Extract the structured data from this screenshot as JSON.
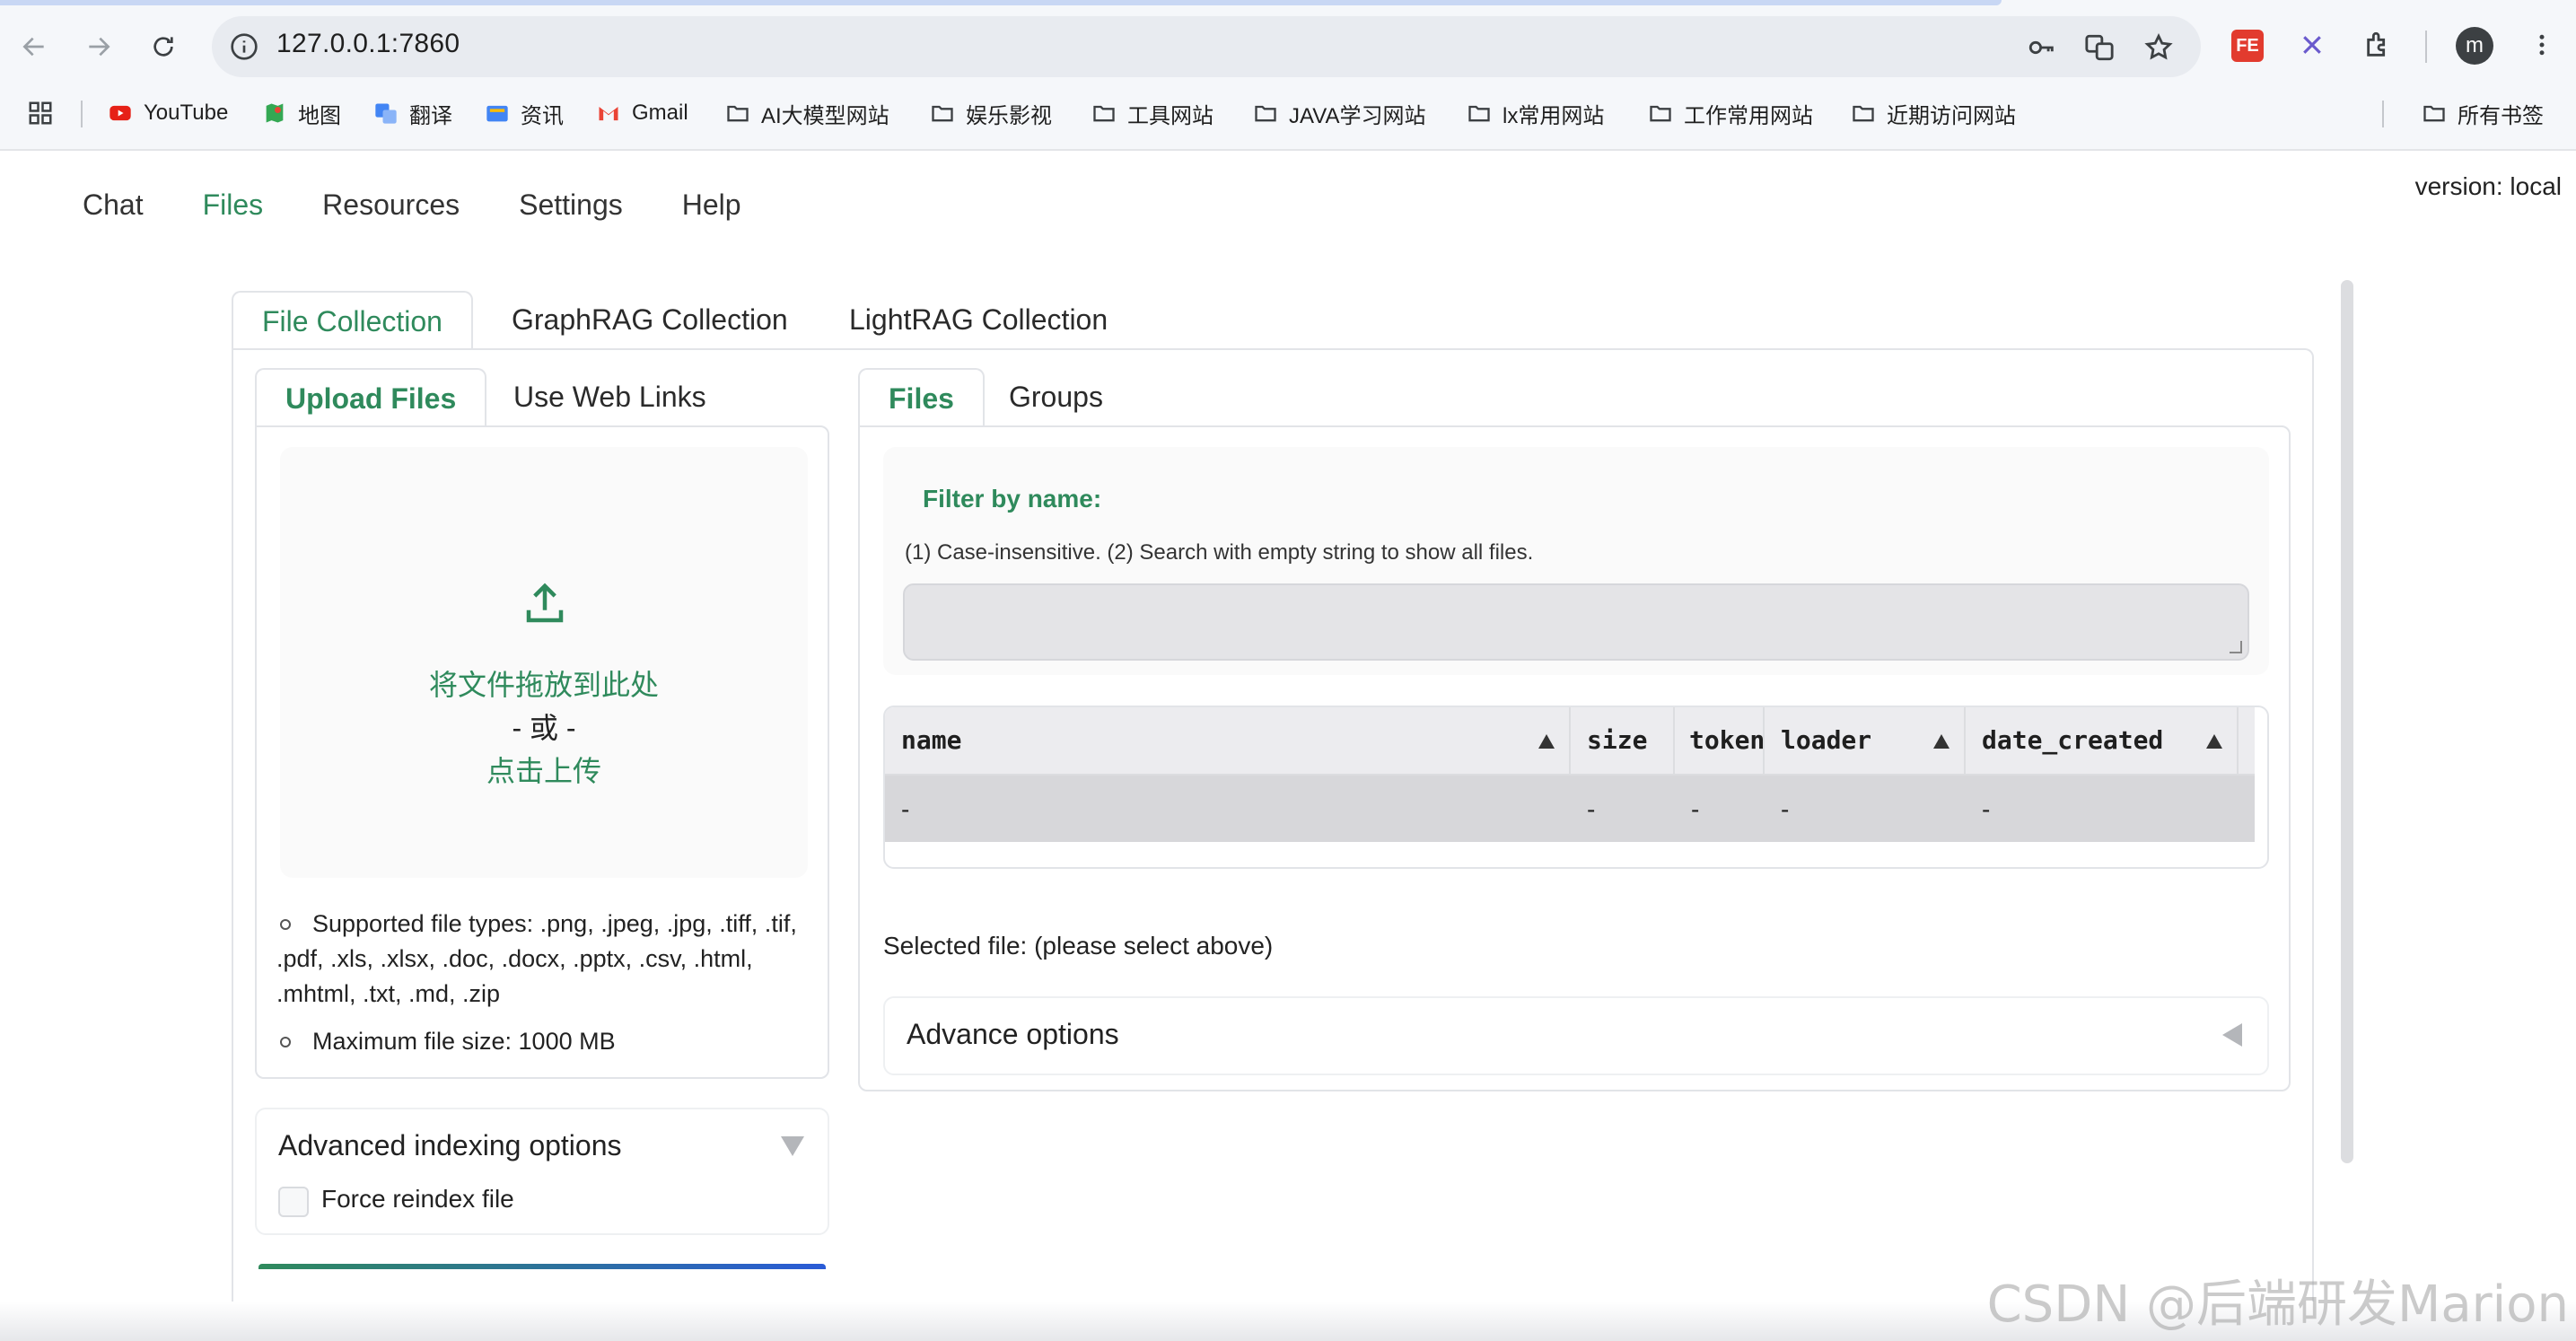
{
  "browser": {
    "url": "127.0.0.1:7860",
    "avatar_letter": "m",
    "bookmarks": [
      {
        "label": "YouTube",
        "icon": "youtube-icon"
      },
      {
        "label": "地图",
        "icon": "maps-icon"
      },
      {
        "label": "翻译",
        "icon": "translate-icon"
      },
      {
        "label": "资讯",
        "icon": "news-icon"
      },
      {
        "label": "Gmail",
        "icon": "gmail-icon"
      },
      {
        "label": "AI大模型网站",
        "icon": "folder-icon"
      },
      {
        "label": "娱乐影视",
        "icon": "folder-icon"
      },
      {
        "label": "工具网站",
        "icon": "folder-icon"
      },
      {
        "label": "JAVA学习网站",
        "icon": "folder-icon"
      },
      {
        "label": "lx常用网站",
        "icon": "folder-icon"
      },
      {
        "label": "工作常用网站",
        "icon": "folder-icon"
      },
      {
        "label": "近期访问网站",
        "icon": "folder-icon"
      }
    ],
    "all_bookmarks": "所有书签"
  },
  "app": {
    "nav": [
      "Chat",
      "Files",
      "Resources",
      "Settings",
      "Help"
    ],
    "active_nav": "Files",
    "version": "version: local",
    "accent": "#2f8a5c"
  },
  "collections": {
    "tabs": [
      "File Collection",
      "GraphRAG Collection",
      "LightRAG Collection"
    ],
    "active": "File Collection"
  },
  "upload": {
    "tabs": [
      "Upload Files",
      "Use Web Links"
    ],
    "drop_text": "将文件拖放到此处",
    "or_text": "- 或 -",
    "click_text": "点击上传",
    "notes": [
      "Supported file types: .png, .jpeg, .jpg, .tiff, .tif, .pdf, .xls, .xlsx, .doc, .docx, .pptx, .csv, .html, .mhtml, .txt, .md, .zip",
      "Maximum file size: 1000 MB"
    ],
    "advanced_title": "Advanced indexing options",
    "force_reindex_label": "Force reindex file"
  },
  "files": {
    "tabs": [
      "Files",
      "Groups"
    ],
    "filter_label": "Filter by name:",
    "filter_info": "(1) Case-insensitive. (2) Search with empty string to show all files.",
    "filter_value": "",
    "columns": [
      "name",
      "size",
      "token",
      "loader",
      "date_created"
    ],
    "rows": [
      [
        "-",
        "-",
        "-",
        "-",
        "-"
      ]
    ],
    "selected_file": "Selected file: (please select above)",
    "advance_options": "Advance options"
  },
  "watermark": "CSDN @后端研发Marion"
}
